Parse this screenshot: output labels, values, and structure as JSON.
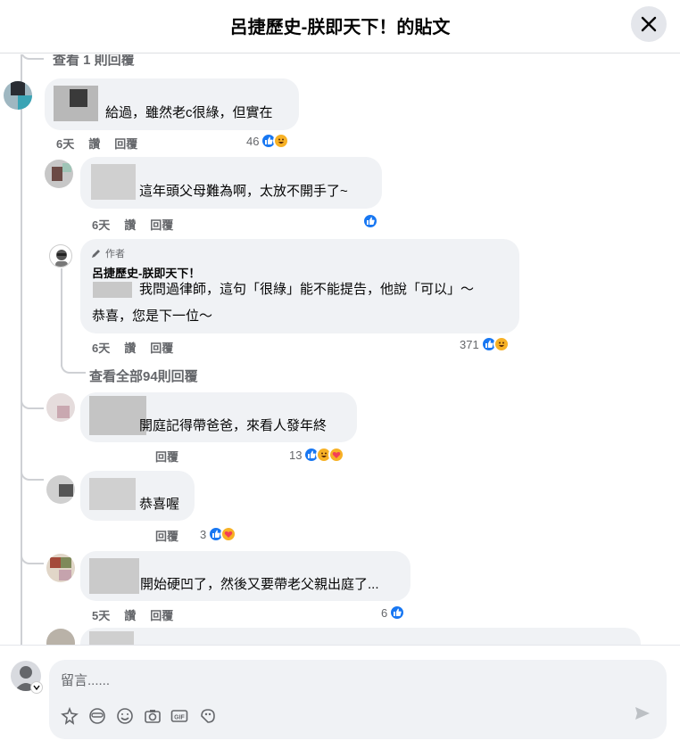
{
  "header": {
    "title": "呂捷歷史-朕即天下！的貼文"
  },
  "view_replies_top": "查看 1 則回覆",
  "comments": [
    {
      "text": "給過，雖然老c很綠，但實在",
      "time": "6天",
      "like": "讚",
      "reply": "回覆",
      "count": "46"
    },
    {
      "text": "這年頭父母難為啊，太放不開手了~",
      "time": "6天",
      "like": "讚",
      "reply": "回覆",
      "count": ""
    },
    {
      "badge": "作者",
      "author": "呂捷歷史-朕即天下！",
      "text_line1": "我問過律師，這句「很綠」能不能提告，他說「可以」～",
      "text_line2": "恭喜，您是下一位～",
      "time": "6天",
      "like": "讚",
      "reply": "回覆",
      "count": "371"
    },
    {
      "text": "開庭記得帶爸爸，來看人發年終",
      "time": "",
      "like": "",
      "reply": "回覆",
      "count": "13"
    },
    {
      "text": "恭喜喔",
      "time": "",
      "like": "",
      "reply": "回覆",
      "count": "3"
    },
    {
      "text": "開始硬凹了，然後又要帶老父親出庭了...",
      "time": "5天",
      "like": "讚",
      "reply": "回覆",
      "count": "6"
    }
  ],
  "view_all_replies": "查看全部94則回覆",
  "composer": {
    "placeholder": "留言......"
  },
  "colors": {
    "like_blue": "#1877f2",
    "haha_yellow": "#f7b125",
    "bubble_bg": "#f0f2f5",
    "meta_gray": "#65676b"
  },
  "icons": [
    "close-icon",
    "pencil-icon",
    "like-icon",
    "haha-icon",
    "care-icon",
    "avatar-icon",
    "sticker-icon",
    "avatar-sticker-icon",
    "emoji-icon",
    "camera-icon",
    "gif-icon",
    "paint-icon",
    "send-icon"
  ]
}
